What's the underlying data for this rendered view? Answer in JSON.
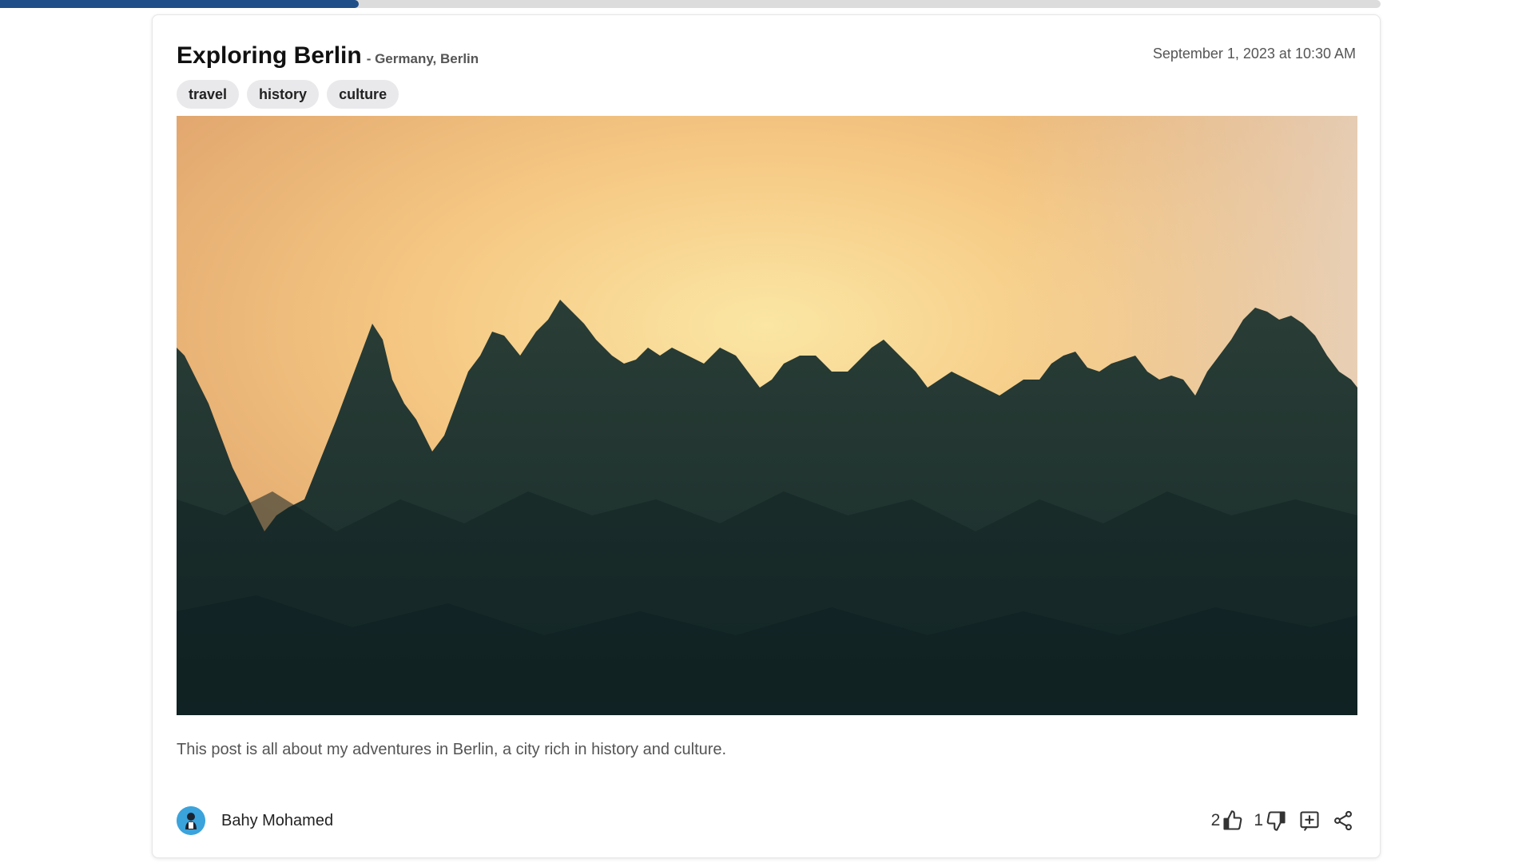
{
  "progress": {
    "fraction": 0.26,
    "fill_color": "#1e4f88",
    "track_color": "#dcdcdc"
  },
  "post": {
    "title": "Exploring Berlin",
    "location": "- Germany, Berlin",
    "date": "September 1, 2023 at 10:30 AM",
    "tags": [
      "travel",
      "history",
      "culture"
    ],
    "image": {
      "subject": "pine-forest-at-sunset",
      "sky_color": "#f3c27a",
      "forest_color": "#1f3532"
    },
    "description": "This post is all about my adventures in Berlin, a city rich in history and culture."
  },
  "author": {
    "name": "Bahy Mohamed",
    "avatar_color": "#3ba3dc"
  },
  "actions": {
    "likes": "2",
    "dislikes": "1",
    "icons": {
      "like": "thumbs-up-icon",
      "dislike": "thumbs-down-icon",
      "add": "add-to-collection-icon",
      "share": "share-icon"
    }
  }
}
